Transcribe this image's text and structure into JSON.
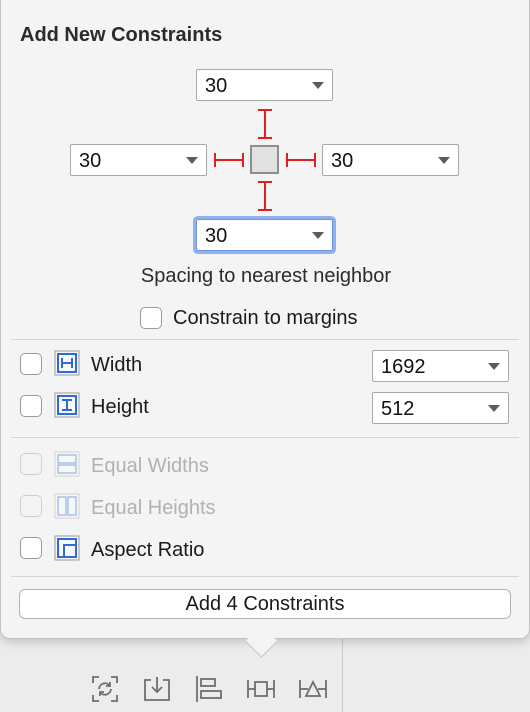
{
  "title": "Add New Constraints",
  "spacing": {
    "top": "30",
    "left": "30",
    "right": "30",
    "bottom": "30",
    "label": "Spacing to nearest neighbor"
  },
  "constrain_margins": {
    "label": "Constrain to margins",
    "checked": false
  },
  "size": {
    "width": {
      "label": "Width",
      "value": "1692",
      "checked": false
    },
    "height": {
      "label": "Height",
      "value": "512",
      "checked": false
    }
  },
  "relations": {
    "equal_widths": {
      "label": "Equal Widths",
      "enabled": false
    },
    "equal_heights": {
      "label": "Equal Heights",
      "enabled": false
    },
    "aspect_ratio": {
      "label": "Aspect Ratio",
      "enabled": true
    }
  },
  "add_button": "Add 4 Constraints",
  "colors": {
    "constraint": "#e02020",
    "icon": "#2e6bd6",
    "focus": "#8fb1ee"
  },
  "toolbar_icons": [
    "update-frames-icon",
    "embed-in-icon",
    "align-icon",
    "add-constraints-icon",
    "resolve-issues-icon"
  ]
}
